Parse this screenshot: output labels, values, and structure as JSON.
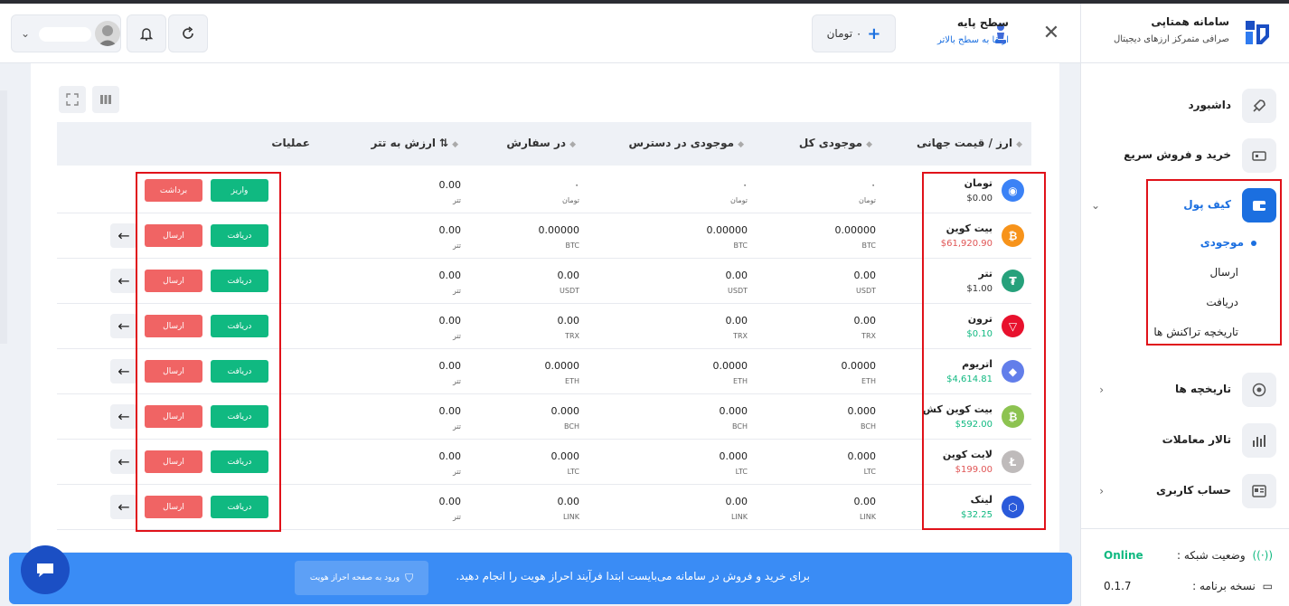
{
  "brand": {
    "name": "سامانه همتاپی",
    "subtitle": "صرافی متمرکز ارزهای دیجیتال"
  },
  "nav": {
    "dashboard": "داشبورد",
    "quick_trade": "خرید و فروش سریع",
    "wallet": "کیف پول",
    "wallet_sub": [
      "موجودی",
      "ارسال",
      "دریافت",
      "تاریخچه تراکنش ها"
    ],
    "history": "تاریخچه ها",
    "trading_hall": "تالار معاملات",
    "account": "حساب کاربری"
  },
  "footer": {
    "network_label": "وضعیت شبکه :",
    "network_value": "Online",
    "version_label": "نسخه برنامه :",
    "version_value": "0.1.7"
  },
  "header": {
    "level_title": "سطح پایه",
    "level_link": "ارتقا به سطح بالاتر",
    "balance": "۰ تومان",
    "close": "✕"
  },
  "table": {
    "headers": {
      "currency": "ارز / قیمت جهانی",
      "total": "موجودی کل",
      "available": "موجودی در دسترس",
      "in_order": "در سفارش",
      "usdt_value": "ارزش به تتر",
      "actions": "عملیات"
    },
    "rows": [
      {
        "name": "تومان",
        "price": "$0.00",
        "price_color": "#333333",
        "icon_color": "#3b82f6",
        "icon": "◉",
        "total": "۰",
        "total_unit": "تومان",
        "available": "۰",
        "available_unit": "تومان",
        "in_order": "۰",
        "in_order_unit": "تومان",
        "usdt": "0.00",
        "usdt_unit": "تتر",
        "btn1": "واریز",
        "btn2": "برداشت",
        "arrow": false
      },
      {
        "name": "بیت کوین",
        "price": "$61,920.90",
        "price_color": "#e05555",
        "icon_color": "#f7931a",
        "icon": "₿",
        "total": "0.00000",
        "total_unit": "BTC",
        "available": "0.00000",
        "available_unit": "BTC",
        "in_order": "0.00000",
        "in_order_unit": "BTC",
        "usdt": "0.00",
        "usdt_unit": "تتر",
        "btn1": "دریافت",
        "btn2": "ارسال",
        "arrow": true
      },
      {
        "name": "تتر",
        "price": "$1.00",
        "price_color": "#333333",
        "icon_color": "#26a17b",
        "icon": "₮",
        "total": "0.00",
        "total_unit": "USDT",
        "available": "0.00",
        "available_unit": "USDT",
        "in_order": "0.00",
        "in_order_unit": "USDT",
        "usdt": "0.00",
        "usdt_unit": "تتر",
        "btn1": "دریافت",
        "btn2": "ارسال",
        "arrow": true
      },
      {
        "name": "ترون",
        "price": "$0.10",
        "price_color": "#10b981",
        "icon_color": "#e8112d",
        "icon": "▽",
        "total": "0.00",
        "total_unit": "TRX",
        "available": "0.00",
        "available_unit": "TRX",
        "in_order": "0.00",
        "in_order_unit": "TRX",
        "usdt": "0.00",
        "usdt_unit": "تتر",
        "btn1": "دریافت",
        "btn2": "ارسال",
        "arrow": true
      },
      {
        "name": "اتریوم",
        "price": "$4,614.81",
        "price_color": "#10b981",
        "icon_color": "#627eea",
        "icon": "◆",
        "total": "0.0000",
        "total_unit": "ETH",
        "available": "0.0000",
        "available_unit": "ETH",
        "in_order": "0.0000",
        "in_order_unit": "ETH",
        "usdt": "0.00",
        "usdt_unit": "تتر",
        "btn1": "دریافت",
        "btn2": "ارسال",
        "arrow": true
      },
      {
        "name": "بیت کوین کش",
        "price": "$592.00",
        "price_color": "#10b981",
        "icon_color": "#8dc351",
        "icon": "₿",
        "total": "0.000",
        "total_unit": "BCH",
        "available": "0.000",
        "available_unit": "BCH",
        "in_order": "0.000",
        "in_order_unit": "BCH",
        "usdt": "0.00",
        "usdt_unit": "تتر",
        "btn1": "دریافت",
        "btn2": "ارسال",
        "arrow": true
      },
      {
        "name": "لایت کوین",
        "price": "$199.00",
        "price_color": "#e05555",
        "icon_color": "#bfbbbb",
        "icon": "Ł",
        "total": "0.000",
        "total_unit": "LTC",
        "available": "0.000",
        "available_unit": "LTC",
        "in_order": "0.000",
        "in_order_unit": "LTC",
        "usdt": "0.00",
        "usdt_unit": "تتر",
        "btn1": "دریافت",
        "btn2": "ارسال",
        "arrow": true
      },
      {
        "name": "لینک",
        "price": "$32.25",
        "price_color": "#10b981",
        "icon_color": "#2a5ada",
        "icon": "⬡",
        "total": "0.00",
        "total_unit": "LINK",
        "available": "0.00",
        "available_unit": "LINK",
        "in_order": "0.00",
        "in_order_unit": "LINK",
        "usdt": "0.00",
        "usdt_unit": "تتر",
        "btn1": "دریافت",
        "btn2": "ارسال",
        "arrow": true
      }
    ]
  },
  "banner": {
    "text": "برای خرید و فروش در سامانه می‌بایست ابتدا فرآیند احراز هویت را انجام دهید.",
    "button": "ورود به صفحه احراز هویت"
  }
}
